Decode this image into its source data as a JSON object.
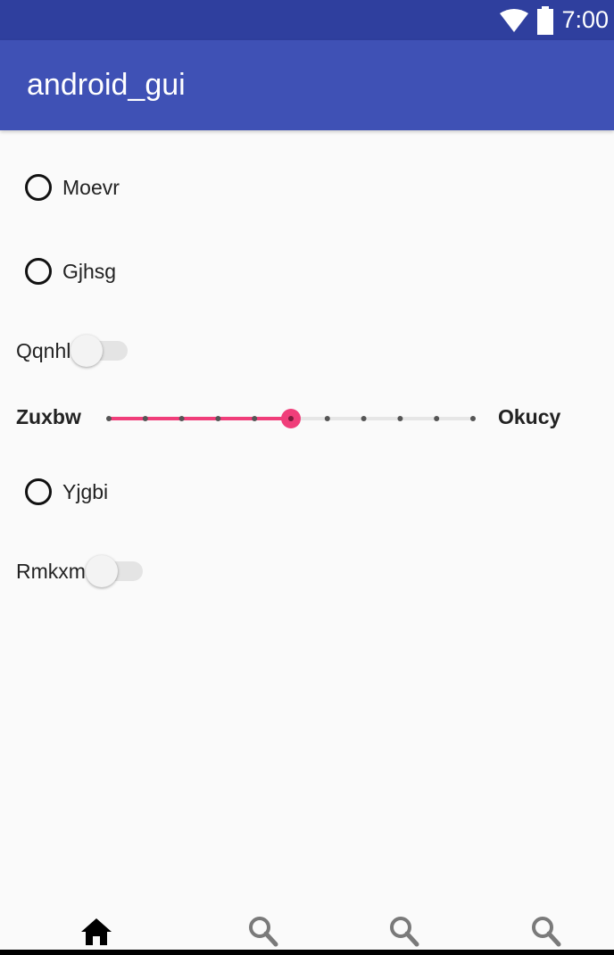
{
  "status_bar": {
    "time": "7:00",
    "wifi_icon": "wifi-icon",
    "battery_icon": "battery-icon",
    "background": "#2f3f9e"
  },
  "app_bar": {
    "title": "android_gui",
    "background": "#3f51b5"
  },
  "radios": [
    {
      "label": "Moevr",
      "checked": false
    },
    {
      "label": "Gjhsg",
      "checked": false
    },
    {
      "label": "Yjgbi",
      "checked": false
    }
  ],
  "switches": [
    {
      "label": "Qqnhl",
      "on": false
    },
    {
      "label": "Rmkxm",
      "on": false
    }
  ],
  "slider": {
    "left_label": "Zuxbw",
    "right_label": "Okucy",
    "steps": 10,
    "value": 5,
    "accent_color": "#f03e7a"
  },
  "bottom_nav": {
    "items": [
      {
        "icon": "home-icon",
        "selected": true
      },
      {
        "icon": "search-icon",
        "selected": false
      },
      {
        "icon": "search-icon",
        "selected": false
      },
      {
        "icon": "search-icon",
        "selected": false
      }
    ]
  }
}
